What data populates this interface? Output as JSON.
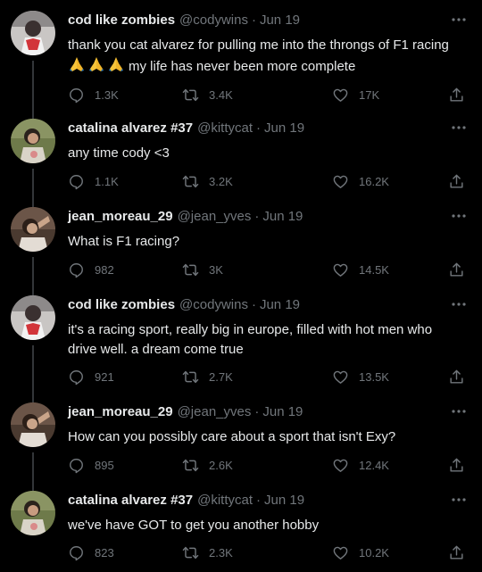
{
  "tweets": [
    {
      "name": "cod like zombies",
      "handle": "@codywins",
      "date": "Jun 19",
      "text_line1": "thank you cat alvarez for pulling me into the throngs of F1 racing",
      "text_line2": "my life has never been more complete",
      "emoji": "folded-hands-emoji x3",
      "replies": "1.3K",
      "retweets": "3.4K",
      "likes": "17K",
      "avatar": "cody"
    },
    {
      "name": "catalina alvarez #37",
      "handle": "@kittycat",
      "date": "Jun 19",
      "text_line1": "any time cody <3",
      "replies": "1.1K",
      "retweets": "3.2K",
      "likes": "16.2K",
      "avatar": "cat"
    },
    {
      "name": "jean_moreau_29",
      "handle": "@jean_yves",
      "date": "Jun 19",
      "text_line1": "What is F1 racing?",
      "replies": "982",
      "retweets": "3K",
      "likes": "14.5K",
      "avatar": "jean"
    },
    {
      "name": "cod like zombies",
      "handle": "@codywins",
      "date": "Jun 19",
      "text_line1": "it's a racing sport, really big in europe, filled with hot men who",
      "text_line2": "drive well. a dream come true",
      "replies": "921",
      "retweets": "2.7K",
      "likes": "13.5K",
      "avatar": "cody"
    },
    {
      "name": "jean_moreau_29",
      "handle": "@jean_yves",
      "date": "Jun 19",
      "text_line1": "How can you possibly care about a sport that isn't Exy?",
      "replies": "895",
      "retweets": "2.6K",
      "likes": "12.4K",
      "avatar": "jean"
    },
    {
      "name": "catalina alvarez #37",
      "handle": "@kittycat",
      "date": "Jun 19",
      "text_line1": "we've have GOT to get you another hobby",
      "replies": "823",
      "retweets": "2.3K",
      "likes": "10.2K",
      "avatar": "cat"
    }
  ],
  "separator": "·",
  "colors": {
    "background": "#000000",
    "text": "#e7e9ea",
    "muted": "#71767b",
    "thread_line": "#333639"
  },
  "icons": [
    "more-icon",
    "reply-icon",
    "retweet-icon",
    "like-icon",
    "share-icon",
    "folded-hands-emoji"
  ]
}
